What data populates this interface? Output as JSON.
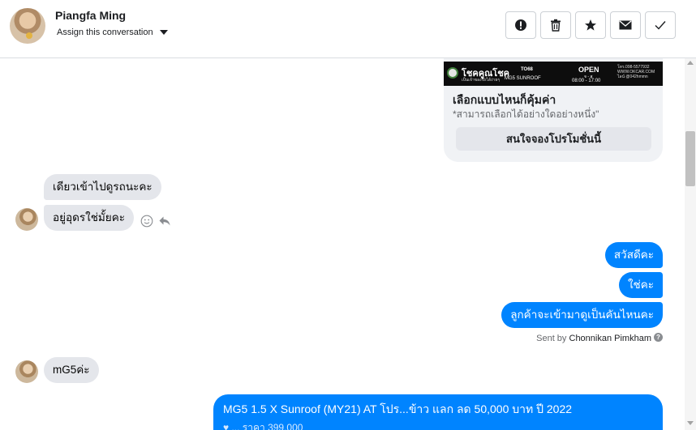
{
  "header": {
    "contact_name": "Piangfa Ming",
    "assign_label": "Assign this conversation",
    "actions": [
      {
        "name": "mark-spam",
        "icon": "alert-icon"
      },
      {
        "name": "delete",
        "icon": "trash-icon"
      },
      {
        "name": "star",
        "icon": "star-icon"
      },
      {
        "name": "mark-unread",
        "icon": "envelope-icon"
      },
      {
        "name": "mark-done",
        "icon": "check-icon"
      }
    ]
  },
  "promo": {
    "banner": {
      "brand": "โชคคูณโชค",
      "brand_sub": "เป็นเจ้าของรถได้ง่ายๆ",
      "code": "TO68",
      "model": "MG5 SUNROOF",
      "open_label": "OPEN",
      "days": "จ - ส",
      "hours": "08:00 - 17:00",
      "contact": "โทร.098-5577932 WWW.OKCAR.COM ไลน์ @042hmmn"
    },
    "title": "เลือกแบบไหนก็คุ้มค่า",
    "subtitle": "*สามารถเลือกได้อย่างใดอย่างหนึ่ง\"",
    "button_label": "สนใจจองโปรโมชั่นนี้"
  },
  "messages": {
    "incoming_1": "เดียวเข้าไปดูรถนะคะ",
    "incoming_2": "อยู่อุดรใช่มั้ยคะ",
    "outgoing_1": "สวัสดีคะ",
    "outgoing_2": "ใช่คะ",
    "outgoing_3": "ลูกค้าจะเข้ามาดูเป็นคันไหนคะ",
    "sent_by_prefix": "Sent by",
    "sent_by_name": "Chonnikan Pimkham",
    "incoming_3": "mG5ค่ะ",
    "outgoing_4_line1": "MG5 1.5 X Sunroof (MY21) AT โปร...ข้าว แลก ลด 50,000 บาท ปี 2022",
    "outgoing_4_line2": "♥ ... ราคา 399,000"
  },
  "colors": {
    "outgoing_bubble": "#0084ff",
    "incoming_bubble": "#e4e6eb",
    "divider": "#dadde1"
  }
}
